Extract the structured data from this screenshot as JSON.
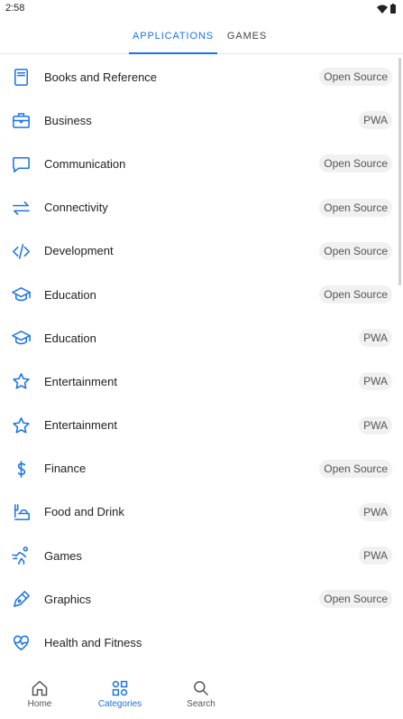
{
  "status": {
    "time": "2:58"
  },
  "tabs": [
    {
      "label": "APPLICATIONS"
    },
    {
      "label": "GAMES"
    }
  ],
  "colors": {
    "accent": "#1a73e8",
    "badge_bg": "#f1f1f1"
  },
  "categories": [
    {
      "label": "Books and Reference",
      "badge": "Open Source",
      "icon": "book-icon"
    },
    {
      "label": "Business",
      "badge": "PWA",
      "icon": "briefcase-icon"
    },
    {
      "label": "Communication",
      "badge": "Open Source",
      "icon": "chat-bubble-icon"
    },
    {
      "label": "Connectivity",
      "badge": "Open Source",
      "icon": "arrows-icon"
    },
    {
      "label": "Development",
      "badge": "Open Source",
      "icon": "code-icon"
    },
    {
      "label": "Education",
      "badge": "Open Source",
      "icon": "graduation-cap-icon"
    },
    {
      "label": "Education",
      "badge": "PWA",
      "icon": "graduation-cap-icon"
    },
    {
      "label": "Entertainment",
      "badge": "PWA",
      "icon": "star-icon"
    },
    {
      "label": "Entertainment",
      "badge": "PWA",
      "icon": "star-icon"
    },
    {
      "label": "Finance",
      "badge": "Open Source",
      "icon": "dollar-icon"
    },
    {
      "label": "Food and Drink",
      "badge": "PWA",
      "icon": "food-icon"
    },
    {
      "label": "Games",
      "badge": "PWA",
      "icon": "running-icon"
    },
    {
      "label": "Graphics",
      "badge": "Open Source",
      "icon": "pen-icon"
    },
    {
      "label": "Health and Fitness",
      "badge": "",
      "icon": "heartbeat-icon"
    }
  ],
  "bottom_nav": [
    {
      "label": "Home",
      "icon": "home-icon"
    },
    {
      "label": "Categories",
      "icon": "categories-icon"
    },
    {
      "label": "Search",
      "icon": "search-icon"
    }
  ]
}
